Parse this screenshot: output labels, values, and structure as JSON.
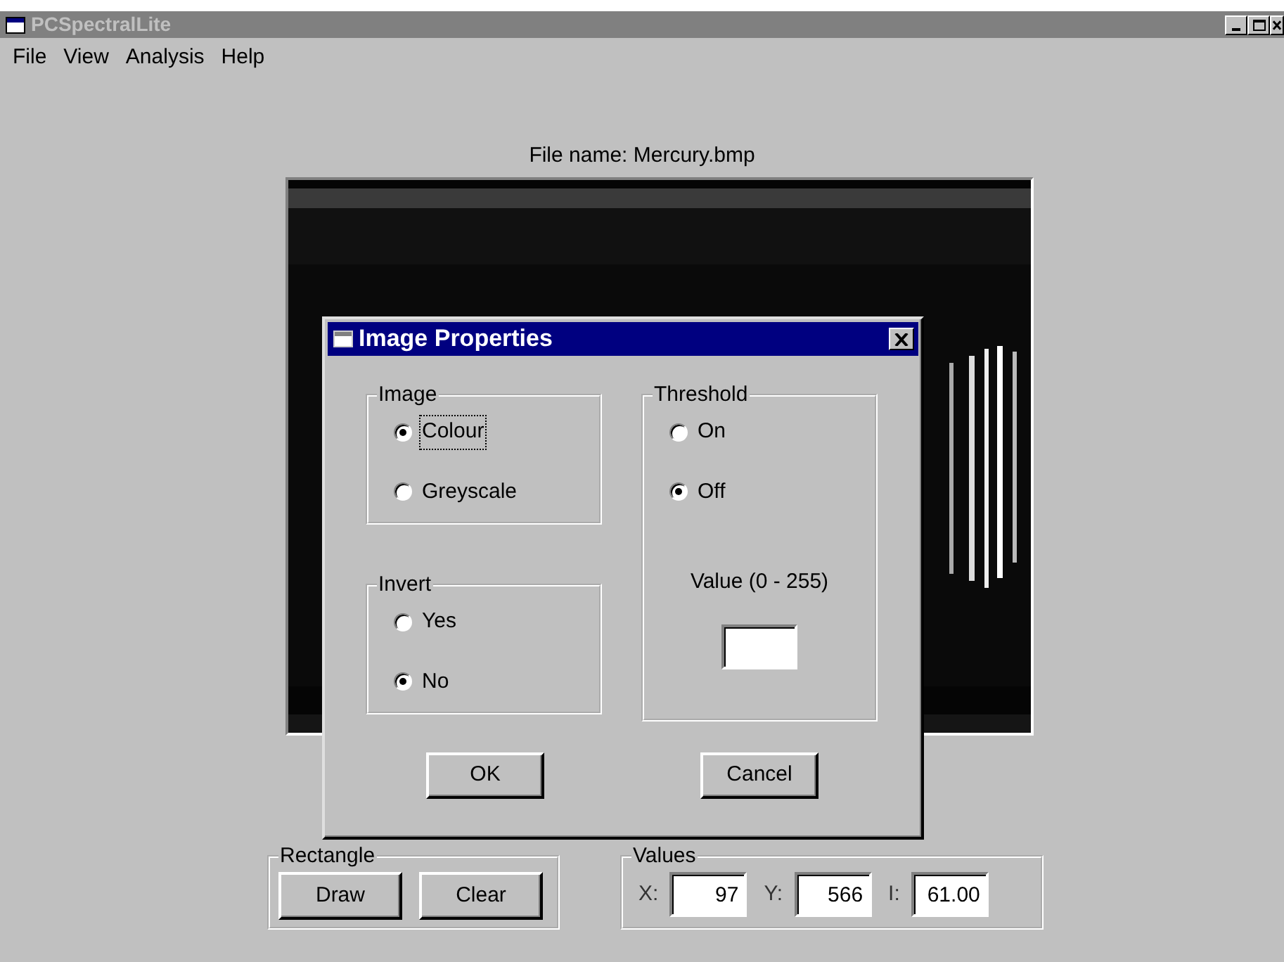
{
  "window": {
    "title": "PCSpectralLite"
  },
  "menu": [
    "File",
    "View",
    "Analysis",
    "Help"
  ],
  "file_name": "File name: Mercury.bmp",
  "dialog": {
    "title": "Image Properties",
    "groups": [
      {
        "title": "Image",
        "options": [
          {
            "label": "Colour",
            "selected": true,
            "focused": true
          },
          {
            "label": "Greyscale",
            "selected": false,
            "focused": false
          }
        ]
      },
      {
        "title": "Invert",
        "options": [
          {
            "label": "Yes",
            "selected": false,
            "focused": false
          },
          {
            "label": "No",
            "selected": true,
            "focused": false
          }
        ]
      },
      {
        "title": "Threshold",
        "options": [
          {
            "label": "On",
            "selected": false,
            "focused": false
          },
          {
            "label": "Off",
            "selected": true,
            "focused": false
          }
        ],
        "field_label": "Value (0 - 255)"
      }
    ],
    "buttons": [
      "OK",
      "Cancel"
    ]
  },
  "rectangle": {
    "title": "Rectangle",
    "buttons": [
      "Draw",
      "Clear"
    ]
  },
  "values": {
    "title": "Values",
    "fields": [
      {
        "label": "X:",
        "value": "97"
      },
      {
        "label": "Y:",
        "value": "566"
      },
      {
        "label": "I:",
        "value": "61.00"
      }
    ]
  }
}
